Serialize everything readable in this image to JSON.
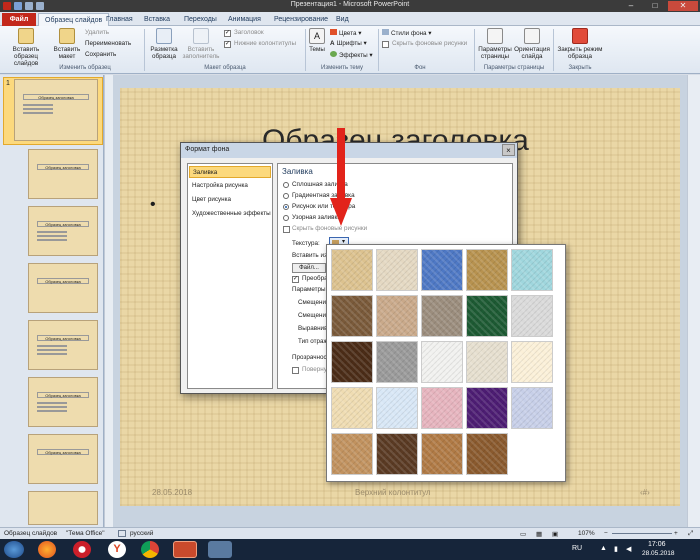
{
  "window": {
    "title": "Презентация1 - Microsoft PowerPoint",
    "minimize": "–",
    "maximize": "□",
    "close": "✕"
  },
  "tabs": {
    "file": "Файл",
    "items": [
      "Образец слайдов",
      "Главная",
      "Вставка",
      "Переходы",
      "Анимация",
      "Рецензирование",
      "Вид"
    ]
  },
  "ribbon": {
    "insert_master": "Вставить образец слайдов",
    "insert_layout": "Вставить макет",
    "delete": "Удалить",
    "rename": "Переименовать",
    "preserve": "Сохранить",
    "group_edit_master": "Изменить образец",
    "master_layout": "Разметка образца",
    "insert_placeholder": "Вставить заполнитель",
    "title_chk": "Заголовок",
    "footers_chk": "Нижние колонтитулы",
    "group_layout": "Макет образца",
    "themes": "Темы",
    "colors": "Цвета",
    "fonts": "Шрифты",
    "effects": "Эффекты",
    "group_theme": "Изменить тему",
    "bg_styles": "Стили фона",
    "hide_bg": "Скрыть фоновые рисунки",
    "group_bg": "Фон",
    "page_setup": "Параметры страницы",
    "orientation": "Ориентация слайда",
    "group_page": "Параметры страницы",
    "close_master": "Закрыть режим образца",
    "group_close": "Закрыть"
  },
  "thumbnails": {
    "title_text": "Образец заголовка",
    "numbers": [
      "1"
    ]
  },
  "slide": {
    "title": "Образец заголовка",
    "bullet": "•",
    "date": "28.05.2018",
    "footer": "Верхний колонтитул",
    "num": "‹#›"
  },
  "dialog": {
    "title": "Формат фона",
    "close": "×",
    "nav": [
      "Заливка",
      "Настройка рисунка",
      "Цвет рисунка",
      "Художественные эффекты"
    ],
    "panel_title": "Заливка",
    "options": [
      "Сплошная заливка",
      "Градиентная заливка",
      "Рисунок или текстура",
      "Узорная заливка"
    ],
    "hide_bg": "Скрыть фоновые рисунки",
    "texture_label": "Текстура:",
    "insert_from": "Вставить из:",
    "file_button": "Файл...",
    "tile_label": "Преобразовать",
    "tiling_params": "Параметры мозаики",
    "offset_x": "Смещение",
    "offset_y": "Смещение",
    "alignment": "Выравнивание",
    "mirror": "Тип отражения",
    "transparency": "Прозрачность",
    "rotate": "Повернуть вместе с фигурой"
  },
  "textures": {
    "colors": [
      "#dcc28f",
      "#e4d8c2",
      "#4e78c4",
      "#b7924f",
      "#9fd6dd",
      "#7a5a3a",
      "#c9a98a",
      "#9b8d7d",
      "#1d5a33",
      "#dadada",
      "#4b2c17",
      "#9a9a9a",
      "#f1f1ef",
      "#e6dfcf",
      "#fbf0d8",
      "#efdcb2",
      "#d8e7f6",
      "#e6b4be",
      "#4d1d73",
      "#c7cfe8",
      "#c1925f",
      "#5a3a23",
      "#b07a45",
      "#8a5a2e",
      "#ffffff"
    ]
  },
  "status": {
    "view": "Образец слайдов",
    "theme": "\"Тема Office\"",
    "lang": "русский",
    "zoom": "107%"
  },
  "taskbar": {
    "lang": "RU",
    "time": "17:06",
    "date": "28.05.2018"
  },
  "colors": {
    "red_arrow": "#e2231a",
    "file_tab": "#c3281b",
    "slide_bg": "#ead7a6"
  }
}
